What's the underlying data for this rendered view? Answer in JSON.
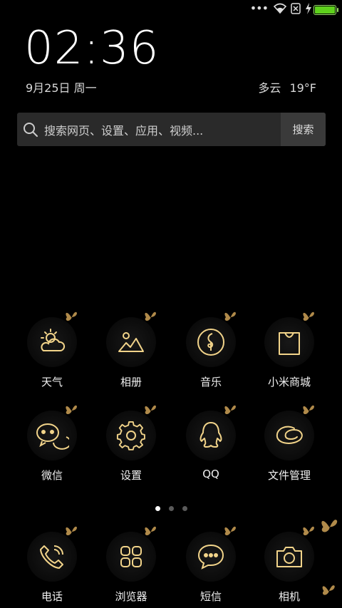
{
  "clock": {
    "time": "02:36",
    "date": "9月25日 周一"
  },
  "weather": {
    "condition": "多云",
    "temperature": "19°F"
  },
  "search": {
    "placeholder": "搜索网页、设置、应用、视频...",
    "button": "搜索"
  },
  "apps_row1": [
    {
      "label": "天气",
      "icon": "weather-icon"
    },
    {
      "label": "相册",
      "icon": "gallery-icon"
    },
    {
      "label": "音乐",
      "icon": "music-icon"
    },
    {
      "label": "小米商城",
      "icon": "store-icon"
    }
  ],
  "apps_row2": [
    {
      "label": "微信",
      "icon": "wechat-icon"
    },
    {
      "label": "设置",
      "icon": "settings-icon"
    },
    {
      "label": "QQ",
      "icon": "qq-icon"
    },
    {
      "label": "文件管理",
      "icon": "file-manager-icon"
    }
  ],
  "dock": [
    {
      "label": "电话",
      "icon": "phone-icon"
    },
    {
      "label": "浏览器",
      "icon": "browser-icon"
    },
    {
      "label": "短信",
      "icon": "messages-icon"
    },
    {
      "label": "相机",
      "icon": "camera-icon"
    }
  ],
  "pages": {
    "count": 3,
    "active": 1
  },
  "status": {
    "battery_level": 1.0
  },
  "colors": {
    "icon_gold": "#f2d48a",
    "battery_green": "#5ed11c",
    "background": "#000000"
  }
}
